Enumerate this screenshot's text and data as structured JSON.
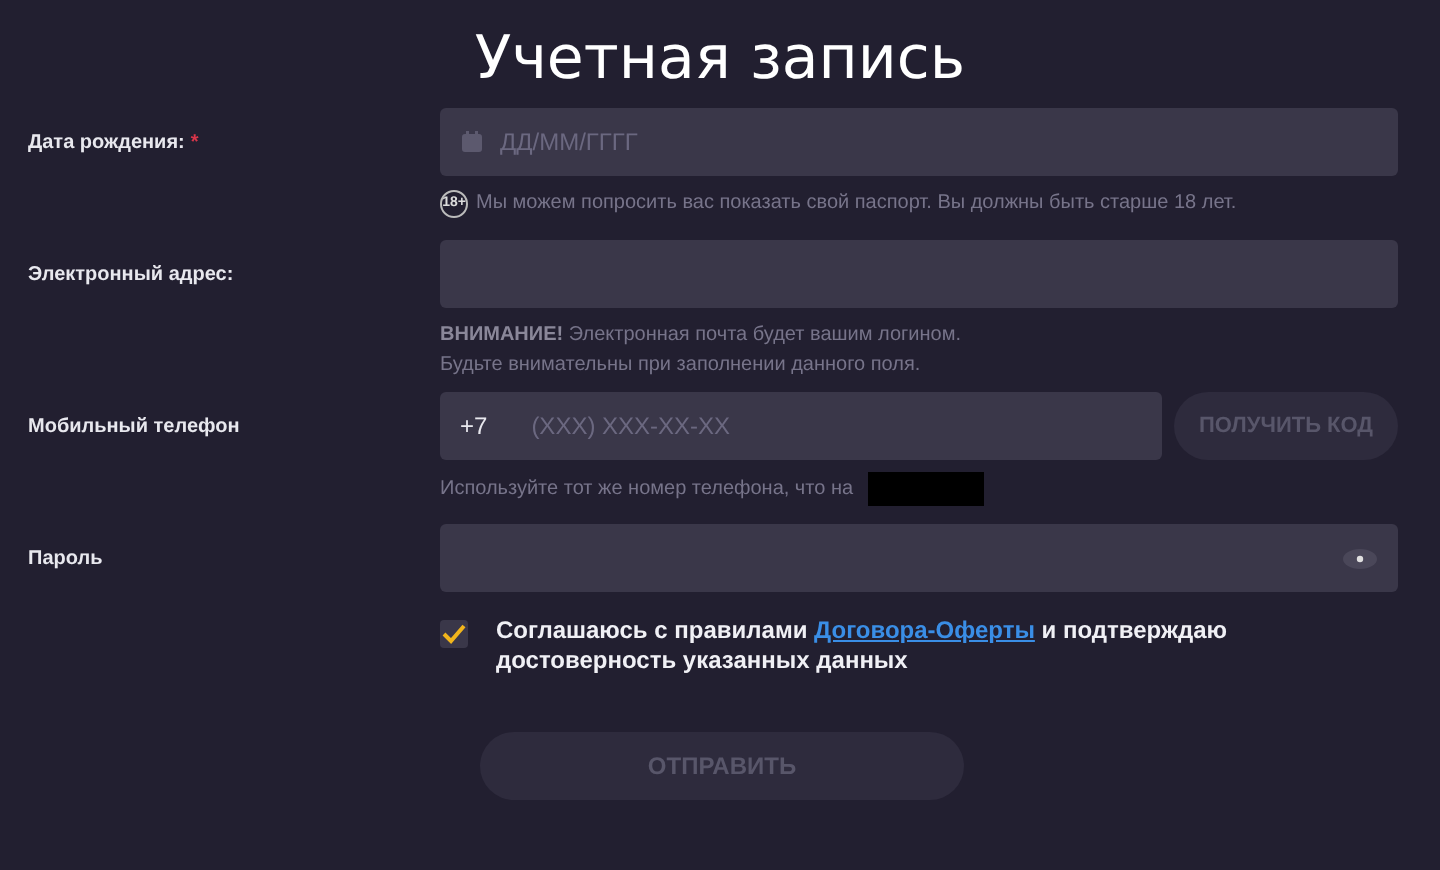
{
  "title": "Учетная запись",
  "fields": [
    {
      "kind": "date",
      "label": "Дата рождения:",
      "required_mark": "*",
      "placeholder": "ДД/ММ/ГГГГ",
      "badge": "18+",
      "hints": [
        "Мы можем попросить вас показать свой паспорт. Вы должны быть старше 18 лет."
      ]
    },
    {
      "kind": "text",
      "label": "Электронный адрес:",
      "hints": [
        "**ВНИМАНИЕ!** Электронная почта будет вашим логином.",
        "Будьте внимательны при заполнении данного поля."
      ]
    },
    {
      "kind": "phone",
      "label": "Мобильный телефон",
      "prefix": "+7",
      "placeholder": "(XXX) XXX-XX-XX",
      "button": "ПОЛУЧИТЬ КОД",
      "hints": [
        "Используйте тот же номер телефона, что на"
      ],
      "redacted": true
    },
    {
      "kind": "password",
      "label": "Пароль"
    }
  ],
  "agreement": {
    "checked": true,
    "before": "Соглашаюсь с правилами ",
    "link": "Договора-Оферты",
    "after": " и подтверждаю достоверность указанных данных"
  },
  "submit": {
    "label": "ОТПРАВИТЬ",
    "disabled": true
  }
}
